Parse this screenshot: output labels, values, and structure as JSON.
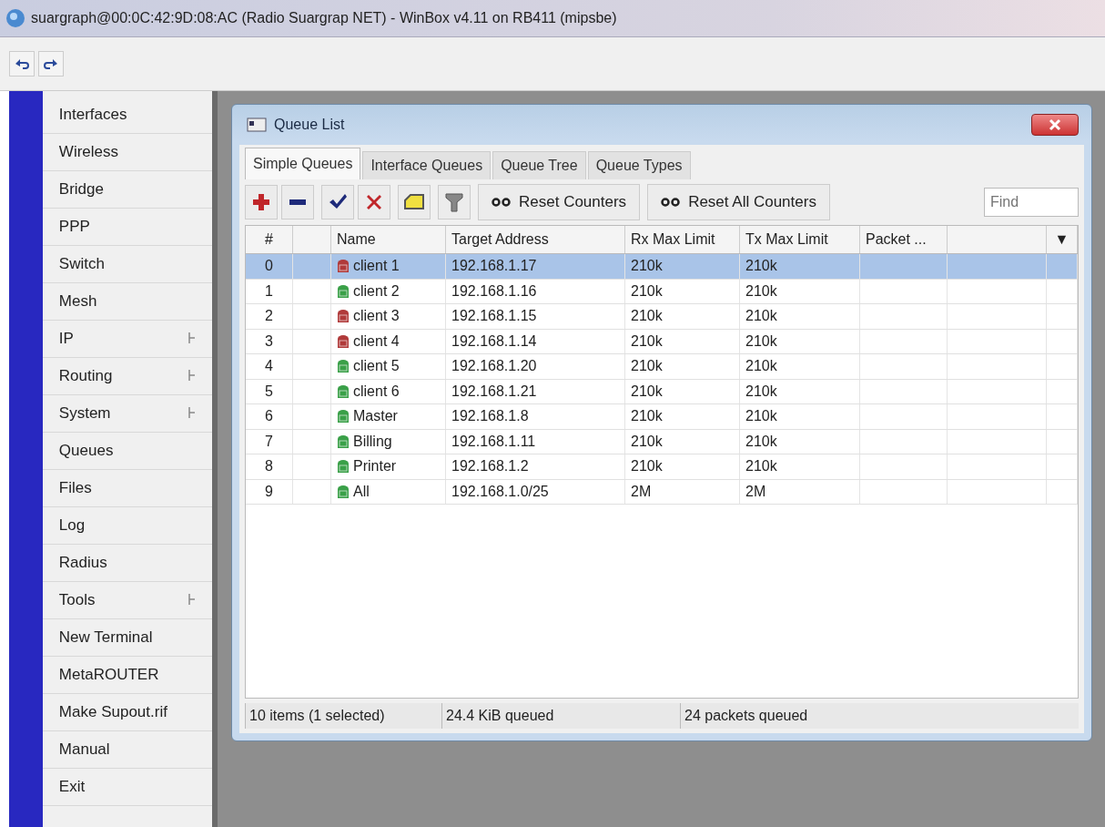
{
  "window": {
    "title": "suargraph@00:0C:42:9D:08:AC (Radio Suargrap NET) - WinBox v4.11 on RB411 (mipsbe)"
  },
  "sidebar": {
    "items": [
      {
        "label": "Interfaces",
        "submenu": false
      },
      {
        "label": "Wireless",
        "submenu": false
      },
      {
        "label": "Bridge",
        "submenu": false
      },
      {
        "label": "PPP",
        "submenu": false
      },
      {
        "label": "Switch",
        "submenu": false
      },
      {
        "label": "Mesh",
        "submenu": false
      },
      {
        "label": "IP",
        "submenu": true
      },
      {
        "label": "Routing",
        "submenu": true
      },
      {
        "label": "System",
        "submenu": true
      },
      {
        "label": "Queues",
        "submenu": false
      },
      {
        "label": "Files",
        "submenu": false
      },
      {
        "label": "Log",
        "submenu": false
      },
      {
        "label": "Radius",
        "submenu": false
      },
      {
        "label": "Tools",
        "submenu": true
      },
      {
        "label": "New Terminal",
        "submenu": false
      },
      {
        "label": "MetaROUTER",
        "submenu": false
      },
      {
        "label": "Make Supout.rif",
        "submenu": false
      },
      {
        "label": "Manual",
        "submenu": false
      },
      {
        "label": "Exit",
        "submenu": false
      }
    ]
  },
  "queue_window": {
    "title": "Queue List",
    "tabs": [
      {
        "label": "Simple Queues",
        "selected": true
      },
      {
        "label": "Interface Queues",
        "selected": false
      },
      {
        "label": "Queue Tree",
        "selected": false
      },
      {
        "label": "Queue Types",
        "selected": false
      }
    ],
    "toolbar": {
      "buttons": [
        {
          "label": "Reset Counters"
        },
        {
          "label": "Reset All Counters"
        }
      ],
      "search": {
        "placeholder": "Find"
      }
    },
    "table": {
      "columns": [
        "#",
        "Name",
        "Target Address",
        "Rx Max Limit",
        "Tx Max Limit",
        "Packet ...",
        "▼"
      ],
      "rows": [
        {
          "num": "0",
          "name": "client 1",
          "target": "192.168.1.17",
          "rx": "210k",
          "tx": "210k",
          "color": "#b03a3a",
          "selected": true
        },
        {
          "num": "1",
          "name": "client 2",
          "target": "192.168.1.16",
          "rx": "210k",
          "tx": "210k",
          "color": "#3aa048",
          "selected": false
        },
        {
          "num": "2",
          "name": "client 3",
          "target": "192.168.1.15",
          "rx": "210k",
          "tx": "210k",
          "color": "#b03a3a",
          "selected": false
        },
        {
          "num": "3",
          "name": "client 4",
          "target": "192.168.1.14",
          "rx": "210k",
          "tx": "210k",
          "color": "#b03a3a",
          "selected": false
        },
        {
          "num": "4",
          "name": "client 5",
          "target": "192.168.1.20",
          "rx": "210k",
          "tx": "210k",
          "color": "#3aa048",
          "selected": false
        },
        {
          "num": "5",
          "name": "client 6",
          "target": "192.168.1.21",
          "rx": "210k",
          "tx": "210k",
          "color": "#3aa048",
          "selected": false
        },
        {
          "num": "6",
          "name": "Master",
          "target": "192.168.1.8",
          "rx": "210k",
          "tx": "210k",
          "color": "#3aa048",
          "selected": false
        },
        {
          "num": "7",
          "name": "Billing",
          "target": "192.168.1.11",
          "rx": "210k",
          "tx": "210k",
          "color": "#3aa048",
          "selected": false
        },
        {
          "num": "8",
          "name": "Printer",
          "target": "192.168.1.2",
          "rx": "210k",
          "tx": "210k",
          "color": "#3aa048",
          "selected": false
        },
        {
          "num": "9",
          "name": "All",
          "target": "192.168.1.0/25",
          "rx": "2M",
          "tx": "2M",
          "color": "#3aa048",
          "selected": false
        }
      ]
    },
    "status_bar": [
      "10 items (1 selected)",
      "24.4 KiB queued",
      "24 packets queued"
    ]
  }
}
